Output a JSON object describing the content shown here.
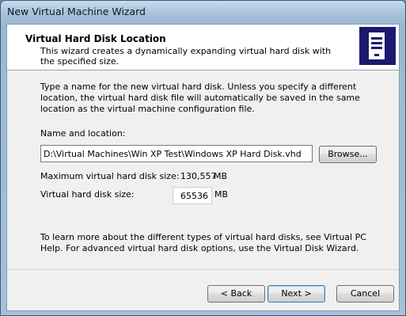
{
  "window": {
    "title": "New Virtual Machine Wizard"
  },
  "header": {
    "title": "Virtual Hard Disk Location",
    "subtitle": "This wizard creates a dynamically expanding virtual hard disk with the specified size.",
    "icon": "computer-tower-icon"
  },
  "body": {
    "description": "Type a name for the new virtual hard disk. Unless you specify a different location, the virtual hard disk file will automatically be saved in the same location as the virtual machine configuration file.",
    "name_label": "Name and location:",
    "path_value": "D:\\Virtual Machines\\Win XP Test\\Windows XP Hard Disk.vhd",
    "browse_label": "Browse...",
    "max_size_label": "Maximum virtual hard disk size:",
    "max_size_value": "130,557",
    "max_size_unit": "MB",
    "size_label": "Virtual hard disk size:",
    "size_value": "65536",
    "size_unit": "MB",
    "help_text": "To learn more about the different types of virtual hard disks, see Virtual PC Help. For advanced virtual hard disk options, use the Virtual Disk Wizard."
  },
  "buttons": {
    "back": "< Back",
    "next": "Next >",
    "cancel": "Cancel"
  }
}
